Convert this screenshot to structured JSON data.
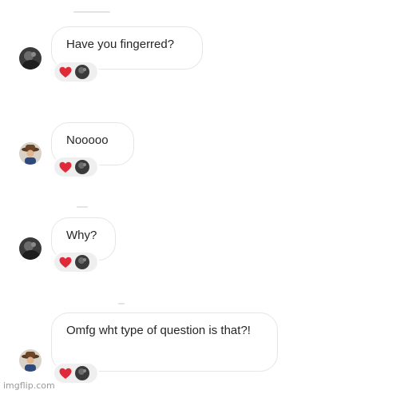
{
  "messages": [
    {
      "text": "Have you fingerred?",
      "sender": "dark-avatar",
      "reaction": "heart"
    },
    {
      "text": "Nooooo",
      "sender": "cowboy-hat-avatar",
      "reaction": "heart"
    },
    {
      "text": "Why?",
      "sender": "dark-avatar",
      "reaction": "heart"
    },
    {
      "text": "Omfg wht type of question is that?!",
      "sender": "cowboy-hat-avatar",
      "reaction": "heart"
    }
  ],
  "watermark": "imgflip.com",
  "colors": {
    "heart": "#e02a3a",
    "bubble_border": "#e6e6e6",
    "reaction_bg": "#efefef",
    "text": "#262626"
  }
}
